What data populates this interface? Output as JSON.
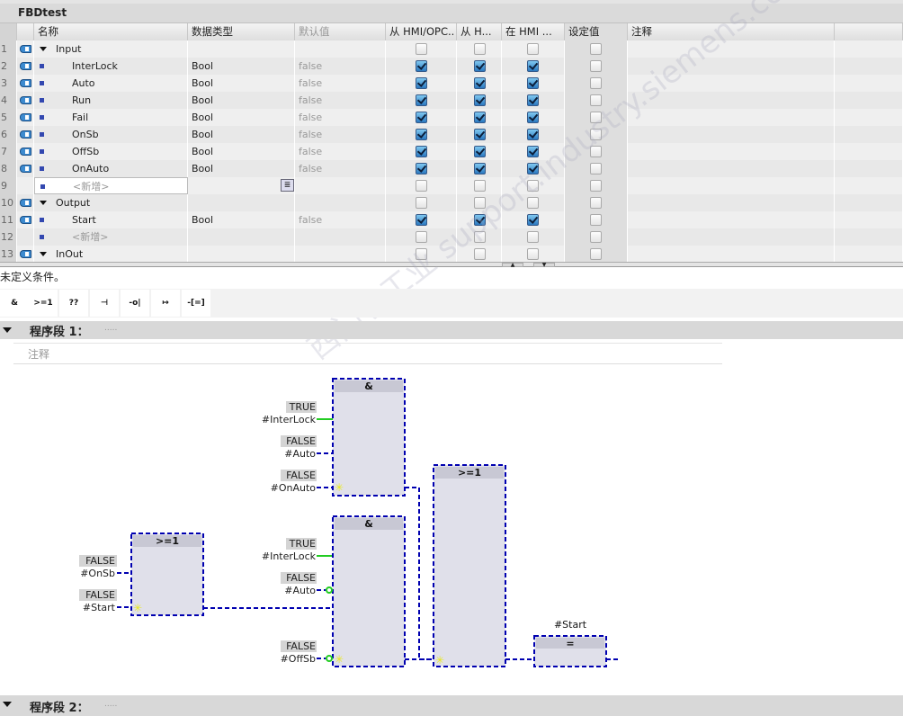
{
  "title": "FBDtest",
  "columns": [
    "",
    "",
    "名称",
    "数据类型",
    "默认值",
    "从 HMI/OPC..",
    "从 H...",
    "在 HMI ...",
    "设定值",
    "注释",
    ""
  ],
  "rows": [
    {
      "n": "1",
      "icon": true,
      "kind": "section",
      "name": "Input",
      "type": "",
      "def": "",
      "c": [
        false,
        false,
        false,
        false
      ]
    },
    {
      "n": "2",
      "icon": true,
      "kind": "var",
      "name": "InterLock",
      "type": "Bool",
      "def": "false",
      "c": [
        true,
        true,
        true,
        false
      ]
    },
    {
      "n": "3",
      "icon": true,
      "kind": "var",
      "name": "Auto",
      "type": "Bool",
      "def": "false",
      "c": [
        true,
        true,
        true,
        false
      ]
    },
    {
      "n": "4",
      "icon": true,
      "kind": "var",
      "name": "Run",
      "type": "Bool",
      "def": "false",
      "c": [
        true,
        true,
        true,
        false
      ]
    },
    {
      "n": "5",
      "icon": true,
      "kind": "var",
      "name": "Fail",
      "type": "Bool",
      "def": "false",
      "c": [
        true,
        true,
        true,
        false
      ]
    },
    {
      "n": "6",
      "icon": true,
      "kind": "var",
      "name": "OnSb",
      "type": "Bool",
      "def": "false",
      "c": [
        true,
        true,
        true,
        false
      ]
    },
    {
      "n": "7",
      "icon": true,
      "kind": "var",
      "name": "OffSb",
      "type": "Bool",
      "def": "false",
      "c": [
        true,
        true,
        true,
        false
      ]
    },
    {
      "n": "8",
      "icon": true,
      "kind": "var",
      "name": "OnAuto",
      "type": "Bool",
      "def": "false",
      "c": [
        true,
        true,
        true,
        false
      ]
    },
    {
      "n": "9",
      "icon": false,
      "kind": "new",
      "name": "<新增>",
      "type": "",
      "def": "",
      "c": [
        false,
        false,
        false,
        false
      ],
      "editing": true
    },
    {
      "n": "10",
      "icon": true,
      "kind": "section",
      "name": "Output",
      "type": "",
      "def": "",
      "c": [
        false,
        false,
        false,
        false
      ]
    },
    {
      "n": "11",
      "icon": true,
      "kind": "var",
      "name": "Start",
      "type": "Bool",
      "def": "false",
      "c": [
        true,
        true,
        true,
        false
      ]
    },
    {
      "n": "12",
      "icon": false,
      "kind": "new",
      "name": "<新增>",
      "type": "",
      "def": "",
      "c": [
        false,
        false,
        false,
        false
      ]
    },
    {
      "n": "13",
      "icon": true,
      "kind": "section",
      "name": "InOut",
      "type": "",
      "def": "",
      "c": [
        false,
        false,
        false,
        false
      ]
    }
  ],
  "status": "未定义条件。",
  "toolbar": [
    "&",
    ">=1",
    "??",
    "⊣",
    "-o|",
    "↦",
    "-[=]"
  ],
  "networks": [
    {
      "title": "程序段 1：",
      "dots": ".....",
      "comment": "注释"
    },
    {
      "title": "程序段 2：",
      "dots": "....."
    }
  ],
  "watermark": "西门子工业 support.industry.siemens.com/cs 技术论坛",
  "diagram": {
    "and1": {
      "op": "&",
      "in": [
        {
          "val": "TRUE",
          "name": "#InterLock"
        },
        {
          "val": "FALSE",
          "name": "#Auto"
        },
        {
          "val": "FALSE",
          "name": "#OnAuto"
        }
      ]
    },
    "and2": {
      "op": "&",
      "in": [
        {
          "val": "TRUE",
          "name": "#InterLock"
        },
        {
          "val": "FALSE",
          "name": "#Auto"
        },
        {
          "val": "FALSE",
          "name": "#OffSb"
        }
      ]
    },
    "or_left": {
      "op": ">=1",
      "in": [
        {
          "val": "FALSE",
          "name": "#OnSb"
        },
        {
          "val": "FALSE",
          "name": "#Start"
        }
      ]
    },
    "or_main": {
      "op": ">=1"
    },
    "coil": {
      "op": "=",
      "name": "#Start"
    }
  },
  "colors": {
    "wire": "#0000b0",
    "true_wire": "#22cc22",
    "box": "#e0e0ea",
    "boxhdr": "#c8c8d4"
  }
}
